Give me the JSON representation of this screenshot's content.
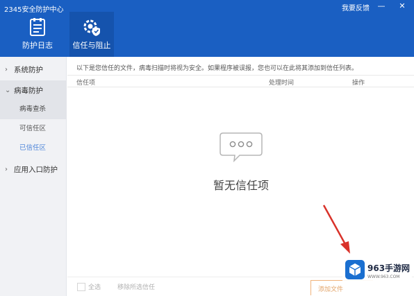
{
  "window": {
    "title": "2345安全防护中心",
    "feedback": "我要反馈",
    "minimize": "—",
    "close": "✕"
  },
  "nav": {
    "tabs": [
      {
        "label": "防护日志",
        "icon": "log-icon",
        "active": false
      },
      {
        "label": "信任与阻止",
        "icon": "shield-gear-icon",
        "active": true
      }
    ]
  },
  "sidebar": {
    "items": [
      {
        "label": "系统防护",
        "state": "collapsed"
      },
      {
        "label": "病毒防护",
        "state": "expanded",
        "children": [
          "病毒查杀",
          "可信任区",
          "已信任区"
        ]
      },
      {
        "label": "应用入口防护",
        "state": "collapsed"
      }
    ],
    "arrow_collapsed": "›",
    "arrow_expanded": "⌄"
  },
  "main": {
    "description": "以下是您信任的文件，病毒扫描时将视为安全。如果程序被误报，您也可以在此将其添加到信任列表。",
    "columns": [
      "信任项",
      "处理时间",
      "操作"
    ],
    "empty_text": "暂无信任项"
  },
  "footer": {
    "select_all": "全选",
    "remove": "移除所选信任",
    "add": "添加文件"
  },
  "watermark": {
    "name": "963手游网",
    "url": "WWW.963.COM"
  },
  "colors": {
    "header": "#1a5fc2",
    "accent_link": "#4f86d9",
    "arrow": "#d9322a"
  }
}
